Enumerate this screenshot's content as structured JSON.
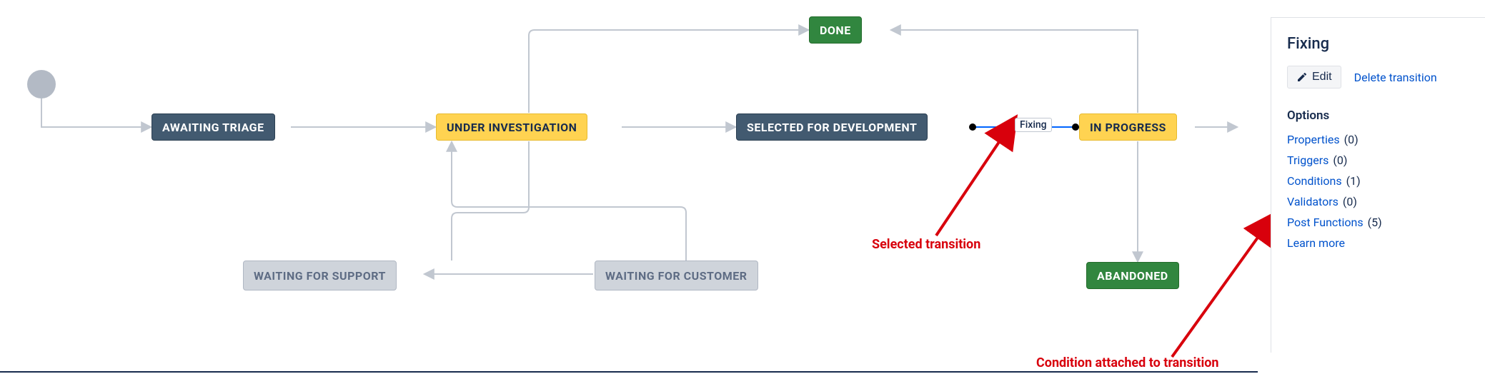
{
  "workflow": {
    "statuses": {
      "awaiting_triage": {
        "label": "AWAITING TRIAGE",
        "kind": "navy"
      },
      "under_investigation": {
        "label": "UNDER INVESTIGATION",
        "kind": "yellow"
      },
      "selected_for_dev": {
        "label": "SELECTED FOR DEVELOPMENT",
        "kind": "navy"
      },
      "in_progress": {
        "label": "IN PROGRESS",
        "kind": "yellow"
      },
      "done": {
        "label": "DONE",
        "kind": "green"
      },
      "abandoned": {
        "label": "ABANDONED",
        "kind": "green"
      },
      "waiting_for_support": {
        "label": "WAITING FOR SUPPORT",
        "kind": "grey"
      },
      "waiting_for_customer": {
        "label": "WAITING FOR CUSTOMER",
        "kind": "grey"
      }
    },
    "selected_transition": {
      "name": "Fixing",
      "from": "selected_for_dev",
      "to": "in_progress"
    }
  },
  "side_panel": {
    "title": "Fixing",
    "edit_label": "Edit",
    "delete_label": "Delete transition",
    "options_header": "Options",
    "options": [
      {
        "label": "Properties",
        "count": "(0)"
      },
      {
        "label": "Triggers",
        "count": "(0)"
      },
      {
        "label": "Conditions",
        "count": "(1)"
      },
      {
        "label": "Validators",
        "count": "(0)"
      },
      {
        "label": "Post Functions",
        "count": "(5)"
      }
    ],
    "learn_more": "Learn more"
  },
  "annotations": {
    "selected_transition": "Selected transition",
    "condition_attached": "Condition attached to transition"
  },
  "colors": {
    "navy": "#425a70",
    "yellow": "#ffd351",
    "green": "#31863f",
    "grey": "#cfd4db",
    "connector": "#c1c7d0",
    "highlight": "#0065ff",
    "red": "#d8000c",
    "link": "#0052cc"
  }
}
